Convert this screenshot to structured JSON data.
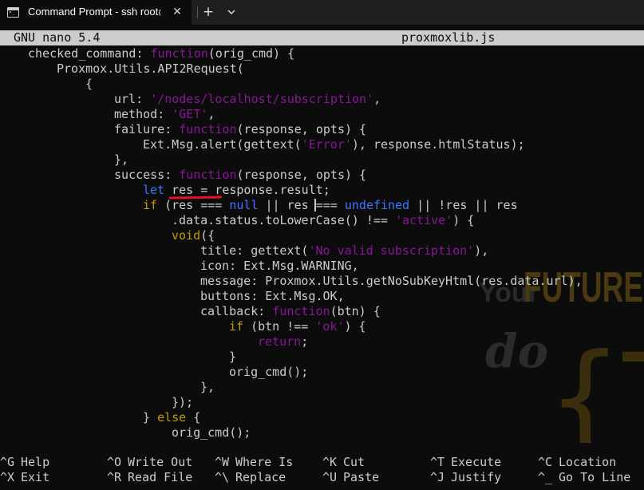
{
  "window": {
    "tab_title": "Command Prompt - ssh  root@",
    "new_tab_label": "+"
  },
  "nano": {
    "version": "GNU nano 5.4",
    "filename": "proxmoxlib.js"
  },
  "code_lines": [
    [
      {
        "t": "checked_command",
        "c": "key"
      },
      {
        "t": ": ",
        "c": "plain"
      },
      {
        "t": "function",
        "c": "kw"
      },
      {
        "t": "(orig_cmd) {",
        "c": "plain"
      }
    ],
    [
      {
        "t": "Proxmox.Utils.API2Request(",
        "c": "plain"
      }
    ],
    [
      {
        "t": "{",
        "c": "plain"
      }
    ],
    [
      {
        "t": "url",
        "c": "key"
      },
      {
        "t": ": ",
        "c": "plain"
      },
      {
        "t": "'/nodes/localhost/subscription'",
        "c": "str"
      },
      {
        "t": ",",
        "c": "plain"
      }
    ],
    [
      {
        "t": "method",
        "c": "key"
      },
      {
        "t": ": ",
        "c": "plain"
      },
      {
        "t": "'GET'",
        "c": "str"
      },
      {
        "t": ",",
        "c": "plain"
      }
    ],
    [
      {
        "t": "failure",
        "c": "key"
      },
      {
        "t": ": ",
        "c": "plain"
      },
      {
        "t": "function",
        "c": "kw"
      },
      {
        "t": "(response, opts) {",
        "c": "plain"
      }
    ],
    [
      {
        "t": "Ext.Msg.alert(gettext(",
        "c": "plain"
      },
      {
        "t": "'Error'",
        "c": "str"
      },
      {
        "t": "), response.htmlStatus);",
        "c": "plain"
      }
    ],
    [
      {
        "t": "},",
        "c": "plain"
      }
    ],
    [
      {
        "t": "success",
        "c": "key"
      },
      {
        "t": ": ",
        "c": "plain"
      },
      {
        "t": "function",
        "c": "kw"
      },
      {
        "t": "(response, opts) {",
        "c": "plain"
      }
    ],
    [
      {
        "t": "let",
        "c": "lit"
      },
      {
        "t": " res = response.result;",
        "c": "plain"
      }
    ],
    [
      {
        "t": "if",
        "c": "flow"
      },
      {
        "t": " (res === ",
        "c": "plain"
      },
      {
        "t": "null",
        "c": "lit"
      },
      {
        "t": " || res === ",
        "c": "plain"
      },
      {
        "t": "undefined",
        "c": "lit"
      },
      {
        "t": " || !res || res",
        "c": "plain"
      }
    ],
    [
      {
        "t": ".data.status.toLowerCase() !== ",
        "c": "plain"
      },
      {
        "t": "'active'",
        "c": "str"
      },
      {
        "t": ") {",
        "c": "plain"
      }
    ],
    [
      {
        "t": "void",
        "c": "flow"
      },
      {
        "t": "({",
        "c": "plain"
      }
    ],
    [
      {
        "t": "title",
        "c": "key"
      },
      {
        "t": ": gettext(",
        "c": "plain"
      },
      {
        "t": "'No valid subscription'",
        "c": "str"
      },
      {
        "t": "),",
        "c": "plain"
      }
    ],
    [
      {
        "t": "icon",
        "c": "key"
      },
      {
        "t": ": Ext.Msg.WARNING,",
        "c": "plain"
      }
    ],
    [
      {
        "t": "message",
        "c": "key"
      },
      {
        "t": ": Proxmox.Utils.getNoSubKeyHtml(res.data.url),",
        "c": "plain"
      }
    ],
    [
      {
        "t": "buttons",
        "c": "key"
      },
      {
        "t": ": Ext.Msg.OK,",
        "c": "plain"
      }
    ],
    [
      {
        "t": "callback",
        "c": "key"
      },
      {
        "t": ": ",
        "c": "plain"
      },
      {
        "t": "function",
        "c": "kw"
      },
      {
        "t": "(btn) {",
        "c": "plain"
      }
    ],
    [
      {
        "t": "if",
        "c": "flow"
      },
      {
        "t": " (btn !== ",
        "c": "plain"
      },
      {
        "t": "'ok'",
        "c": "str"
      },
      {
        "t": ") {",
        "c": "plain"
      }
    ],
    [
      {
        "t": "return",
        "c": "kw"
      },
      {
        "t": ";",
        "c": "plain"
      }
    ],
    [
      {
        "t": "}",
        "c": "plain"
      }
    ],
    [
      {
        "t": "orig_cmd();",
        "c": "plain"
      }
    ],
    [
      {
        "t": "},",
        "c": "plain"
      }
    ],
    [
      {
        "t": "});",
        "c": "plain"
      }
    ],
    [
      {
        "t": "} ",
        "c": "plain"
      },
      {
        "t": "else",
        "c": "flow"
      },
      {
        "t": " {",
        "c": "plain"
      }
    ],
    [
      {
        "t": "orig_cmd();",
        "c": "plain"
      }
    ]
  ],
  "shortcuts": [
    {
      "key": "^G",
      "label": "Help"
    },
    {
      "key": "^X",
      "label": "Exit"
    },
    {
      "key": "^O",
      "label": "Write Out"
    },
    {
      "key": "^R",
      "label": "Read File"
    },
    {
      "key": "^W",
      "label": "Where Is"
    },
    {
      "key": "^\\",
      "label": "Replace"
    },
    {
      "key": "^K",
      "label": "Cut"
    },
    {
      "key": "^U",
      "label": "Paste"
    },
    {
      "key": "^T",
      "label": "Execute"
    },
    {
      "key": "^J",
      "label": "Justify"
    },
    {
      "key": "^C",
      "label": "Location"
    },
    {
      "key": "^_",
      "label": "Go To Line"
    }
  ],
  "watermark": {
    "words": [
      "Your",
      "FUTURE",
      "do",
      "{T"
    ]
  },
  "colors": {
    "terminal_bg": "#0c0c0c",
    "text": "#cccccc",
    "keyword_purple": "#881798",
    "literal_blue": "#3b78ff",
    "flow_yellow": "#c19c00",
    "annotation_red": "#e81123",
    "watermark_orange": "#4a3a10"
  }
}
